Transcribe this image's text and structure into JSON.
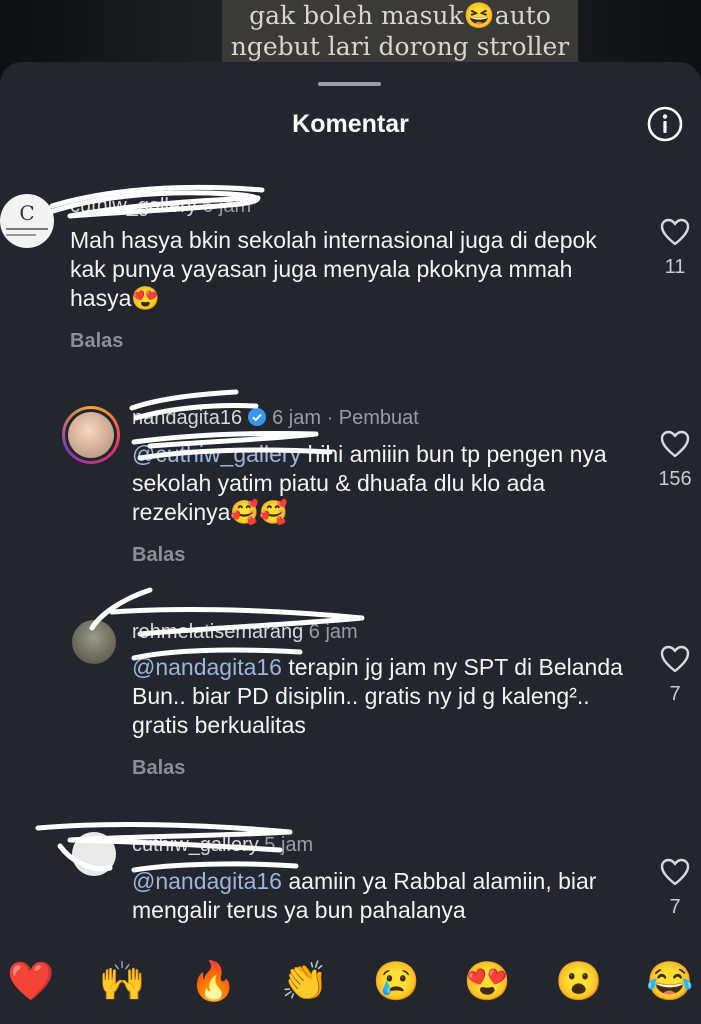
{
  "video_caption": {
    "line1": "gak boleh masuk😆auto",
    "line2": "ngebut lari dorong stroller"
  },
  "sheet": {
    "title": "Komentar"
  },
  "comments": [
    {
      "user": "cuthiw_gallery",
      "time": "6 jam",
      "tag": "",
      "mention": "",
      "text": "Mah hasya bkin sekolah internasional juga di depok kak punya yayasan juga menyala pkoknya mmah hasya😍",
      "reply_label": "Balas",
      "likes": "11"
    },
    {
      "user": "nandagita16",
      "time": "6 jam",
      "tag": "· Pembuat",
      "mention": "@cuthiw_gallery",
      "text": " hihi amiiin bun tp pengen nya sekolah yatim piatu & dhuafa dlu klo ada rezekinya🥰🥰",
      "reply_label": "Balas",
      "likes": "156"
    },
    {
      "user": "rohmelatisemarang",
      "time": "6 jam",
      "tag": "",
      "mention": "@nandagita16",
      "text": " terapin jg jam ny SPT di Belanda Bun.. biar PD disiplin.. gratis ny jd g kaleng².. gratis berkualitas",
      "reply_label": "Balas",
      "likes": "7"
    },
    {
      "user": "cuthiw_gallery",
      "time": "5 jam",
      "tag": "",
      "mention": "@nandagita16",
      "text": " aamiin ya Rabbal alamiin, biar mengalir terus ya bun pahalanya",
      "reply_label": "",
      "likes": "7"
    }
  ],
  "reactions": [
    "❤️",
    "🙌",
    "🔥",
    "👏",
    "😢",
    "😍",
    "😮",
    "😂"
  ],
  "colors": {
    "sheet_bg": "#23262d",
    "mention": "#9fb4d8",
    "verified": "#3797f0"
  },
  "icons": {
    "info": "info-circle-icon",
    "like": "heart-outline-icon"
  }
}
